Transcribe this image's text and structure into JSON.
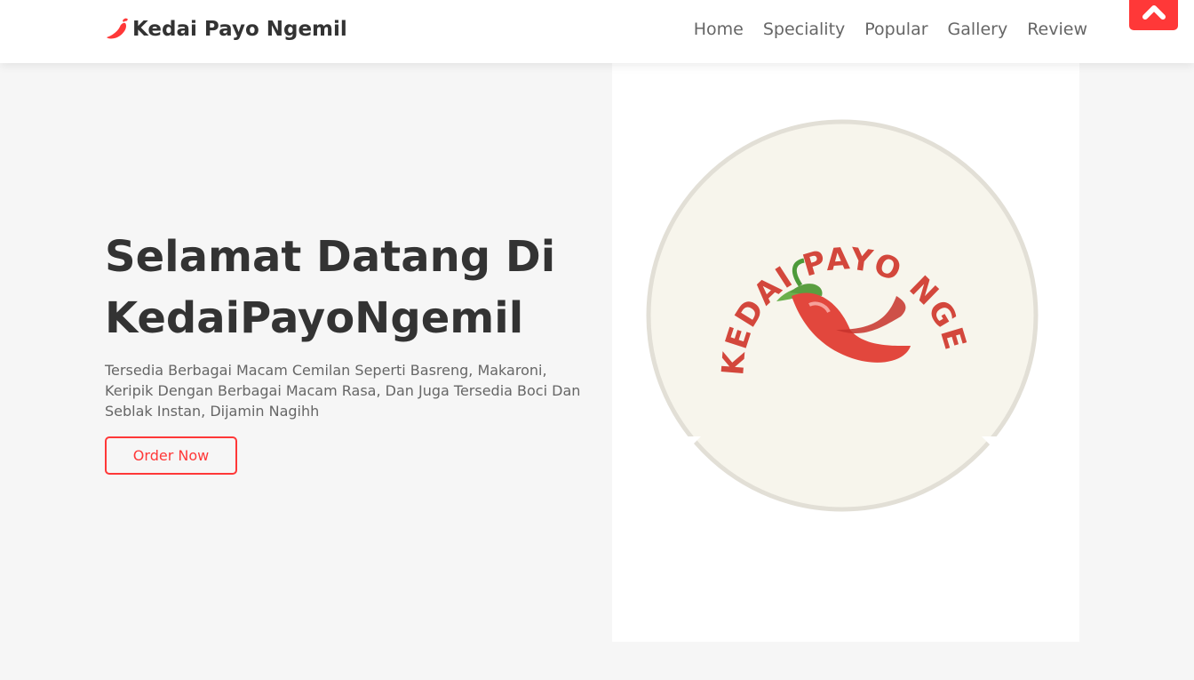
{
  "header": {
    "brand": "Kedai Payo Ngemil",
    "brand_icon": "chili-pepper-icon",
    "nav": [
      "Home",
      "Speciality",
      "Popular",
      "Gallery",
      "Review"
    ],
    "scroll_top_icon": "chevron-up-icon"
  },
  "hero": {
    "title_line1": "Selamat Datang Di",
    "title_line2": "KedaiPayoNgemil",
    "description": "Tersedia Berbagai Macam Cemilan Seperti Basreng, Makaroni, Keripik Dengan Berbagai Macam Rasa, Dan Juga Tersedia Boci Dan Seblak Instan, Dijamin Nagihh",
    "button_label": "Order Now"
  },
  "logo_image": {
    "text": "KEDAI PAYO NGEMIL"
  },
  "colors": {
    "accent": "#ff3838",
    "background": "#f6f6f6",
    "logo_bg": "#f7f5ec",
    "logo_text": "#d3473c"
  }
}
